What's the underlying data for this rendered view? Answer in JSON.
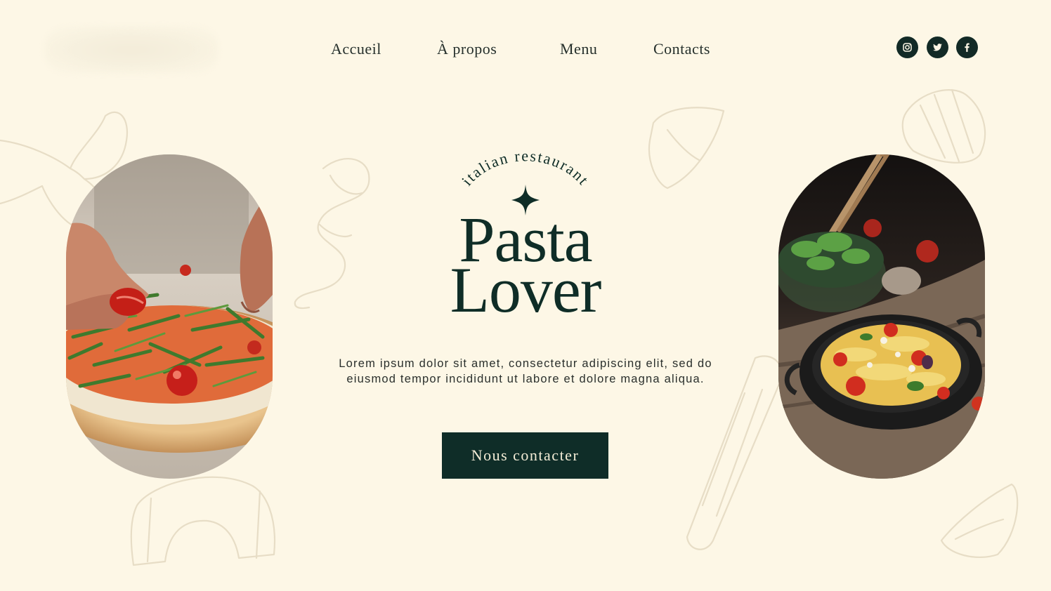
{
  "nav": {
    "items": [
      "Accueil",
      "À propos",
      "Menu",
      "Contacts"
    ]
  },
  "social": {
    "icons": [
      "instagram-icon",
      "twitter-icon",
      "facebook-icon"
    ]
  },
  "hero": {
    "tagline": "italian restaurant",
    "title_line1": "Pasta",
    "title_line2": "Lover",
    "description": "Lorem ipsum dolor sit amet, consectetur adipiscing elit, sed do eiusmod tempor incididunt ut labore et dolore magna aliqua.",
    "cta_label": "Nous contacter"
  },
  "colors": {
    "background": "#fdf7e6",
    "primary": "#0f2d28",
    "decor": "#e7ddc6"
  }
}
